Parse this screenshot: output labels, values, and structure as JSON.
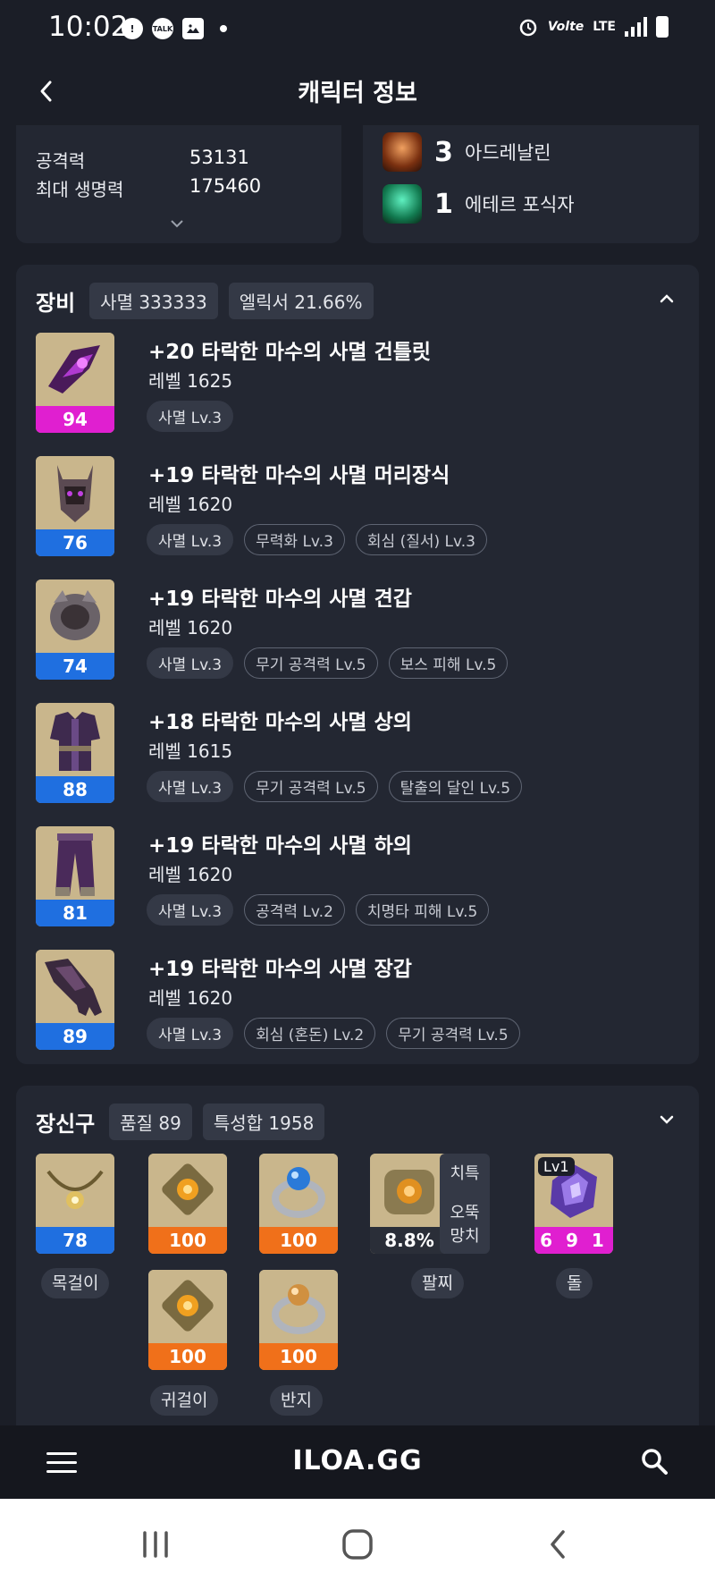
{
  "status_bar": {
    "time": "10:02",
    "talk_label": "TALK",
    "network_label": "Volte",
    "lte_label": "LTE"
  },
  "header": {
    "title": "캐릭터 정보"
  },
  "stats": [
    {
      "label": "공격력",
      "value": "53131"
    },
    {
      "label": "최대 생명력",
      "value": "175460"
    }
  ],
  "engravings": [
    {
      "level": "3",
      "name": "아드레날린",
      "icon": "adrenaline-icon"
    },
    {
      "level": "1",
      "name": "에테르 포식자",
      "icon": "ether-predator-icon"
    }
  ],
  "equipment": {
    "title": "장비",
    "badge_set": "사멸 333333",
    "badge_elixir": "엘릭서 21.66%",
    "items": [
      {
        "name": "+20 타락한 마수의 사멸 건틀릿",
        "level": "레벨 1625",
        "quality": "94",
        "quality_color": "#e01fd0",
        "tags": [
          "사멸 Lv.3"
        ]
      },
      {
        "name": "+19 타락한 마수의 사멸 머리장식",
        "level": "레벨 1620",
        "quality": "76",
        "quality_color": "#1f6fe0",
        "tags": [
          "사멸 Lv.3",
          "무력화 Lv.3",
          "회심 (질서) Lv.3"
        ]
      },
      {
        "name": "+19 타락한 마수의 사멸 견갑",
        "level": "레벨 1620",
        "quality": "74",
        "quality_color": "#1f6fe0",
        "tags": [
          "사멸 Lv.3",
          "무기 공격력 Lv.5",
          "보스 피해 Lv.5"
        ]
      },
      {
        "name": "+18 타락한 마수의 사멸 상의",
        "level": "레벨 1615",
        "quality": "88",
        "quality_color": "#1f6fe0",
        "tags": [
          "사멸 Lv.3",
          "무기 공격력 Lv.5",
          "탈출의 달인 Lv.5"
        ]
      },
      {
        "name": "+19 타락한 마수의 사멸 하의",
        "level": "레벨 1620",
        "quality": "81",
        "quality_color": "#1f6fe0",
        "tags": [
          "사멸 Lv.3",
          "공격력 Lv.2",
          "치명타 피해 Lv.5"
        ]
      },
      {
        "name": "+19 타락한 마수의 사멸 장갑",
        "level": "레벨 1620",
        "quality": "89",
        "quality_color": "#1f6fe0",
        "tags": [
          "사멸 Lv.3",
          "회심 (혼돈) Lv.2",
          "무기 공격력 Lv.5"
        ]
      }
    ]
  },
  "accessories": {
    "title": "장신구",
    "badge_quality": "품질 89",
    "badge_stat": "특성합 1958",
    "necklace": {
      "quality": "78",
      "label": "목걸이"
    },
    "earring_1": {
      "quality": "100"
    },
    "earring_2": {
      "quality": "100"
    },
    "earring_label": "귀걸이",
    "ring_1": {
      "quality": "100"
    },
    "ring_2": {
      "quality": "100"
    },
    "ring_label": "반지",
    "bracelet": {
      "value": "8.8%",
      "label": "팔찌",
      "stat_1": "치특",
      "stat_2a": "오뚝",
      "stat_2b": "망치"
    },
    "stone": {
      "lv": "Lv1",
      "value": "6 9 1",
      "label": "돌"
    }
  },
  "app_bar": {
    "logo": "ILOA.GG"
  },
  "colors": {
    "background": "#1b1e27",
    "card": "#232732",
    "quality_blue": "#1f6fe0",
    "quality_pink": "#e01fd0",
    "quality_orange": "#f0701a"
  }
}
